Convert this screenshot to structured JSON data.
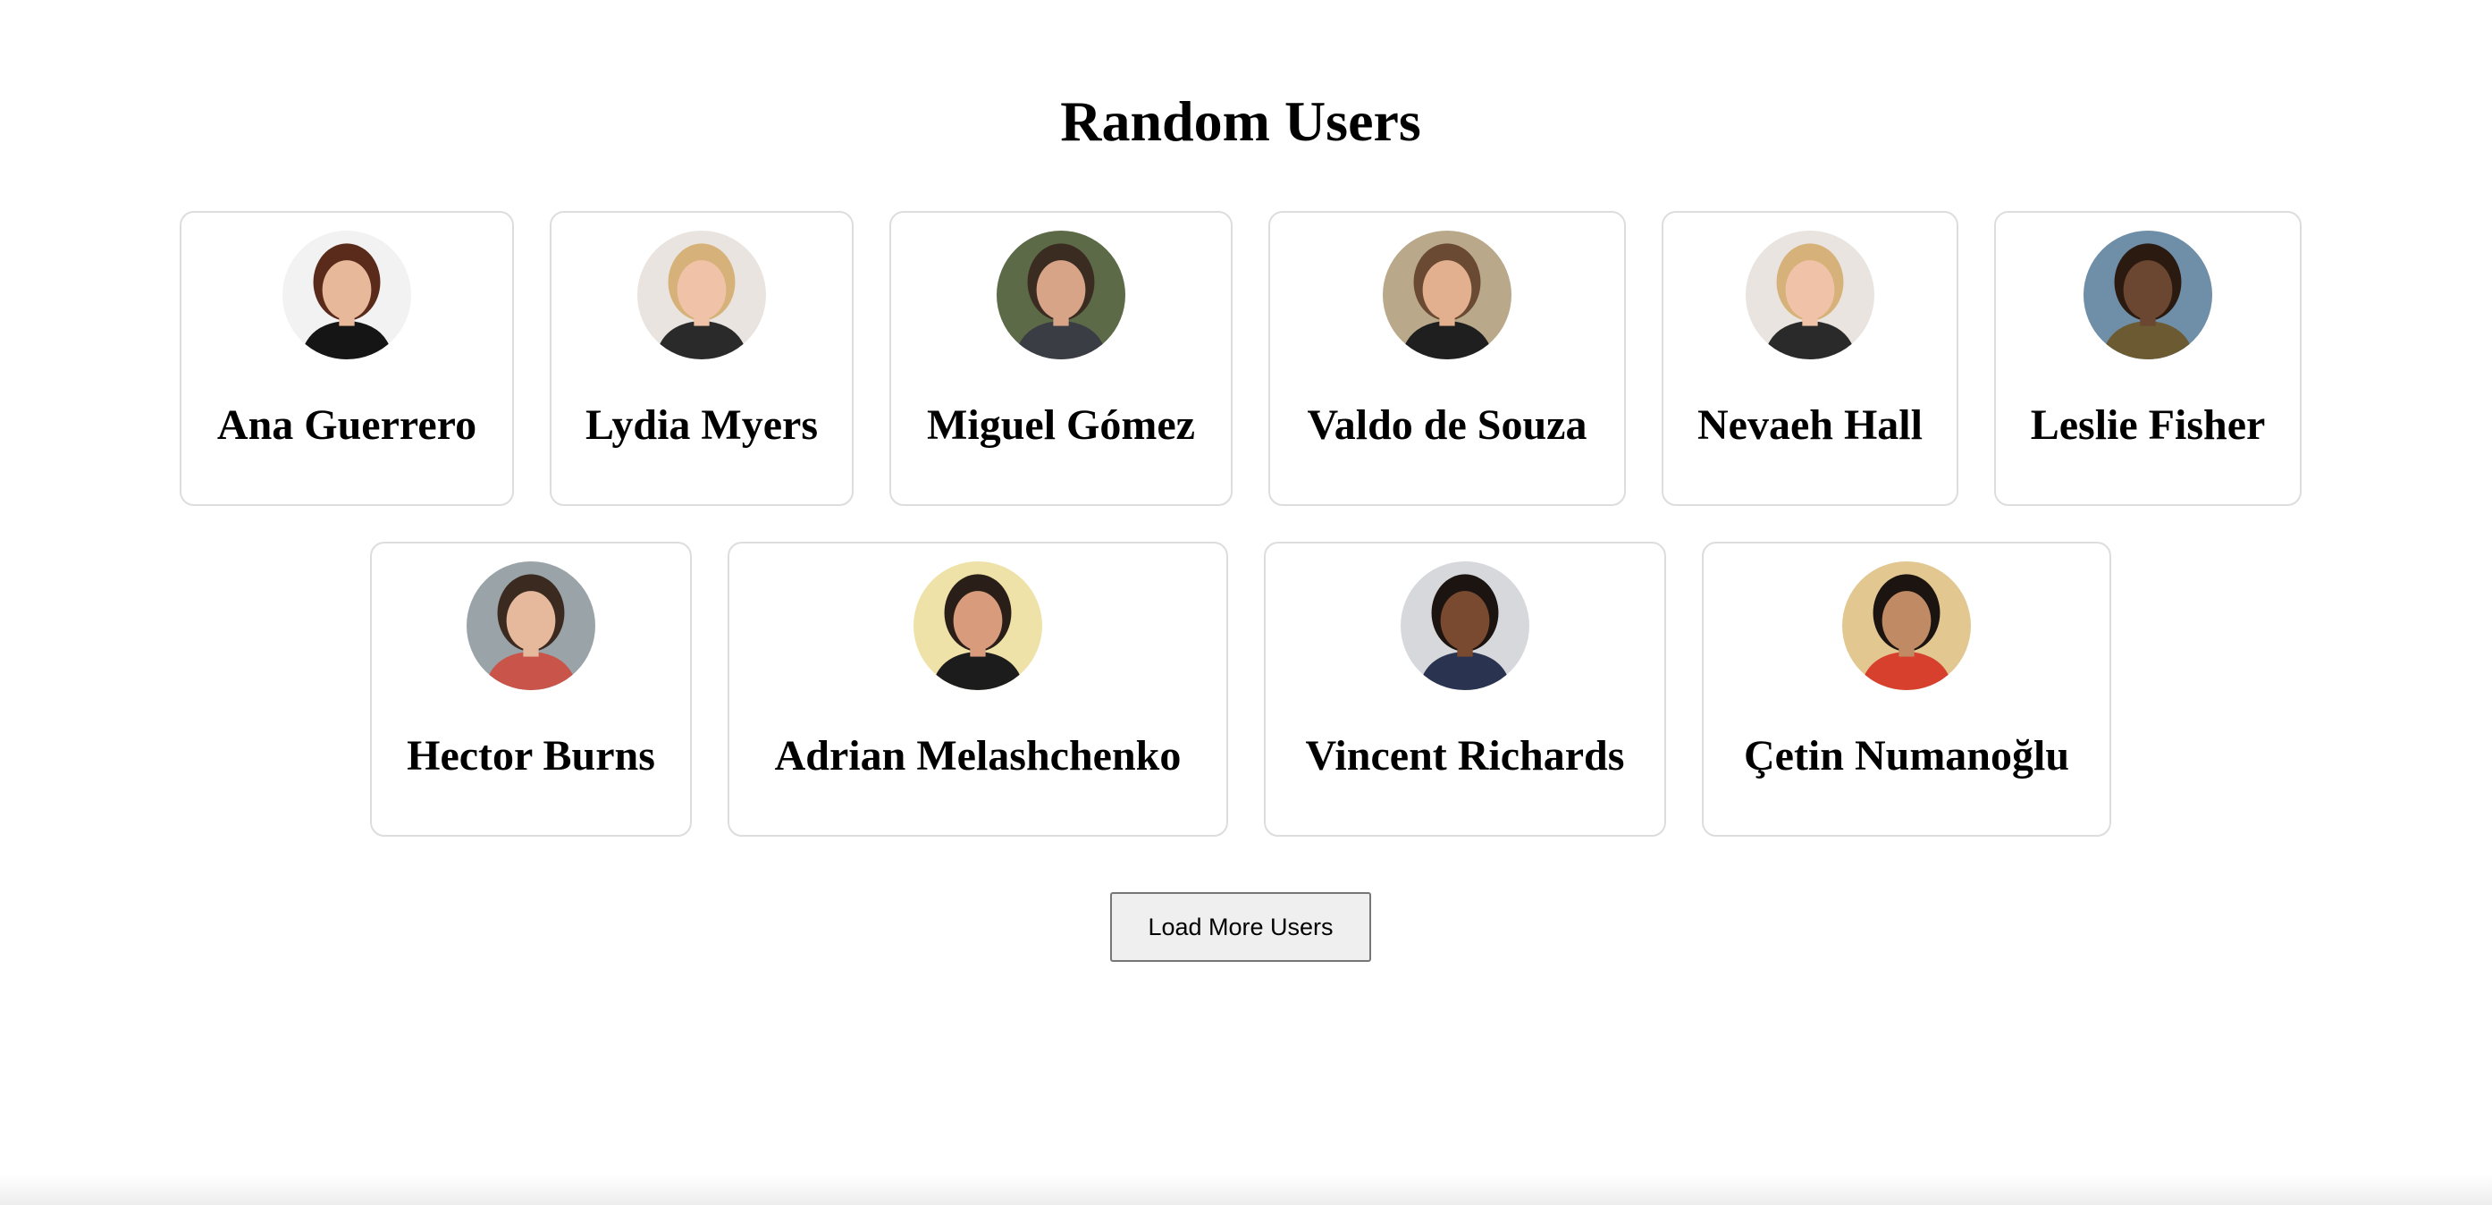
{
  "page": {
    "title": "Random Users"
  },
  "users": [
    {
      "name": "Ana Guerrero",
      "avatar": {
        "bg": "#f2f2f2",
        "skin": "#e8b89a",
        "hair": "#5a2a1a",
        "shirt": "#151515"
      }
    },
    {
      "name": "Lydia Myers",
      "avatar": {
        "bg": "#e9e4df",
        "skin": "#f0c3a8",
        "hair": "#d6b27a",
        "shirt": "#2a2a2a"
      }
    },
    {
      "name": "Miguel Gómez",
      "avatar": {
        "bg": "#5d6a48",
        "skin": "#d8a488",
        "hair": "#3b2c22",
        "shirt": "#3a3e44"
      }
    },
    {
      "name": "Valdo de Souza",
      "avatar": {
        "bg": "#b9a98a",
        "skin": "#e2b08e",
        "hair": "#6a4a32",
        "shirt": "#1f1f1f"
      }
    },
    {
      "name": "Nevaeh Hall",
      "avatar": {
        "bg": "#e9e4df",
        "skin": "#f0c3a8",
        "hair": "#d6b27a",
        "shirt": "#2a2a2a"
      }
    },
    {
      "name": "Leslie Fisher",
      "avatar": {
        "bg": "#6f8ea8",
        "skin": "#6b4630",
        "hair": "#2a1a10",
        "shirt": "#6b5a32"
      }
    },
    {
      "name": "Hector Burns",
      "avatar": {
        "bg": "#9aa4a8",
        "skin": "#e6b89c",
        "hair": "#3a2a20",
        "shirt": "#c8544a"
      }
    },
    {
      "name": "Adrian Melashchenko",
      "avatar": {
        "bg": "#efe2a8",
        "skin": "#d89c7c",
        "hair": "#2a1e18",
        "shirt": "#1c1c1c"
      }
    },
    {
      "name": "Vincent Richards",
      "avatar": {
        "bg": "#d6d8dc",
        "skin": "#7a4a30",
        "hair": "#1c1410",
        "shirt": "#2a3450"
      }
    },
    {
      "name": "Çetin Numanoğlu",
      "avatar": {
        "bg": "#e2c890",
        "skin": "#c08a64",
        "hair": "#1c1410",
        "shirt": "#d8402e"
      }
    }
  ],
  "load_more": {
    "label": "Load More Users"
  }
}
